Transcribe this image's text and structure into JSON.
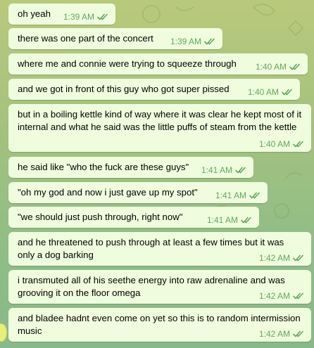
{
  "messages": [
    {
      "text": "oh yeah",
      "time": "1:39 AM"
    },
    {
      "text": "there was one part of the concert",
      "time": "1:39 AM"
    },
    {
      "text": "where me and connie were trying to squeeze through",
      "time": "1:40 AM"
    },
    {
      "text": "and we got in front of this guy who got super pissed",
      "time": "1:40 AM"
    },
    {
      "text": "but in a boiling kettle kind of way where it was clear he kept most of it internal and what he said was the little puffs of steam from the kettle",
      "time": "1:40 AM"
    },
    {
      "text": "he said like \"who the fuck are these guys\"",
      "time": "1:41 AM"
    },
    {
      "text": "\"oh my god and now i just gave up my spot\"",
      "time": "1:41 AM"
    },
    {
      "text": "\"we should just push through, right now\"",
      "time": "1:41 AM"
    },
    {
      "text": "and he threatened to push through at least a few times but it was only a dog barking",
      "time": "1:42 AM"
    },
    {
      "text": "i transmuted all of his seethe energy into raw adrenaline and was grooving it on the floor omega",
      "time": "1:42 AM"
    },
    {
      "text": "and bladee hadnt even come on yet so this is to random intermission music",
      "time": "1:42 AM"
    }
  ],
  "colors": {
    "bubble": "#effdde",
    "timestamp": "#5fa85a",
    "background": "#a5c27e"
  }
}
